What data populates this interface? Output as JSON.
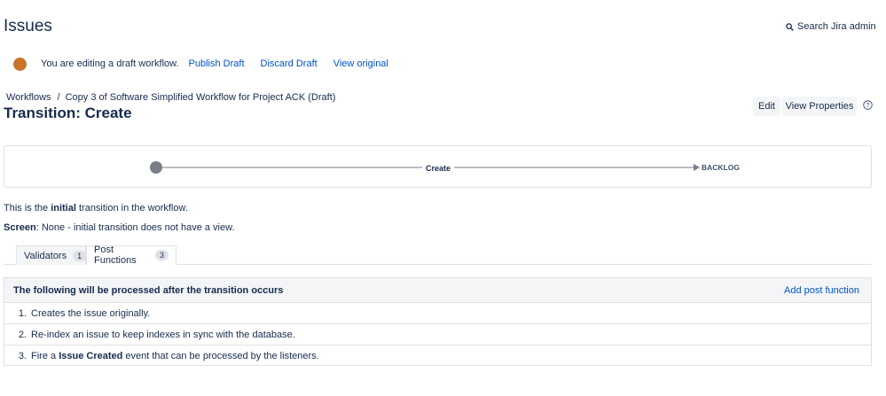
{
  "header": {
    "title": "Issues",
    "search_label": "Search Jira admin"
  },
  "draft_bar": {
    "message": "You are editing a draft workflow.",
    "publish_label": "Publish Draft",
    "discard_label": "Discard Draft",
    "view_original_label": "View original",
    "dot_color": "#c9742b"
  },
  "breadcrumb": {
    "root": "Workflows",
    "separator": "/",
    "current": "Copy 3 of Software Simplified Workflow for Project ACK (Draft)"
  },
  "transition": {
    "title": "Transition: Create"
  },
  "actions": {
    "edit_label": "Edit",
    "view_properties_label": "View Properties"
  },
  "diagram": {
    "transition_label": "Create",
    "target_status": "BACKLOG"
  },
  "description": {
    "line1_prefix": "This is the ",
    "line1_bold": "initial",
    "line1_suffix": " transition in the workflow.",
    "screen_label": "Screen",
    "screen_value": ": None - initial transition does not have a view."
  },
  "tabs": [
    {
      "label": "Validators",
      "count": "1",
      "active": false
    },
    {
      "label": "Post Functions",
      "count": "3",
      "active": true
    }
  ],
  "post_functions": {
    "heading": "The following will be processed after the transition occurs",
    "add_label": "Add post function",
    "items": [
      {
        "num": "1.",
        "pre": "Creates the issue originally.",
        "bold": "",
        "post": ""
      },
      {
        "num": "2.",
        "pre": "Re-index an issue to keep indexes in sync with the database.",
        "bold": "",
        "post": ""
      },
      {
        "num": "3.",
        "pre": "Fire a ",
        "bold": "Issue Created",
        "post": " event that can be processed by the listeners."
      }
    ]
  }
}
